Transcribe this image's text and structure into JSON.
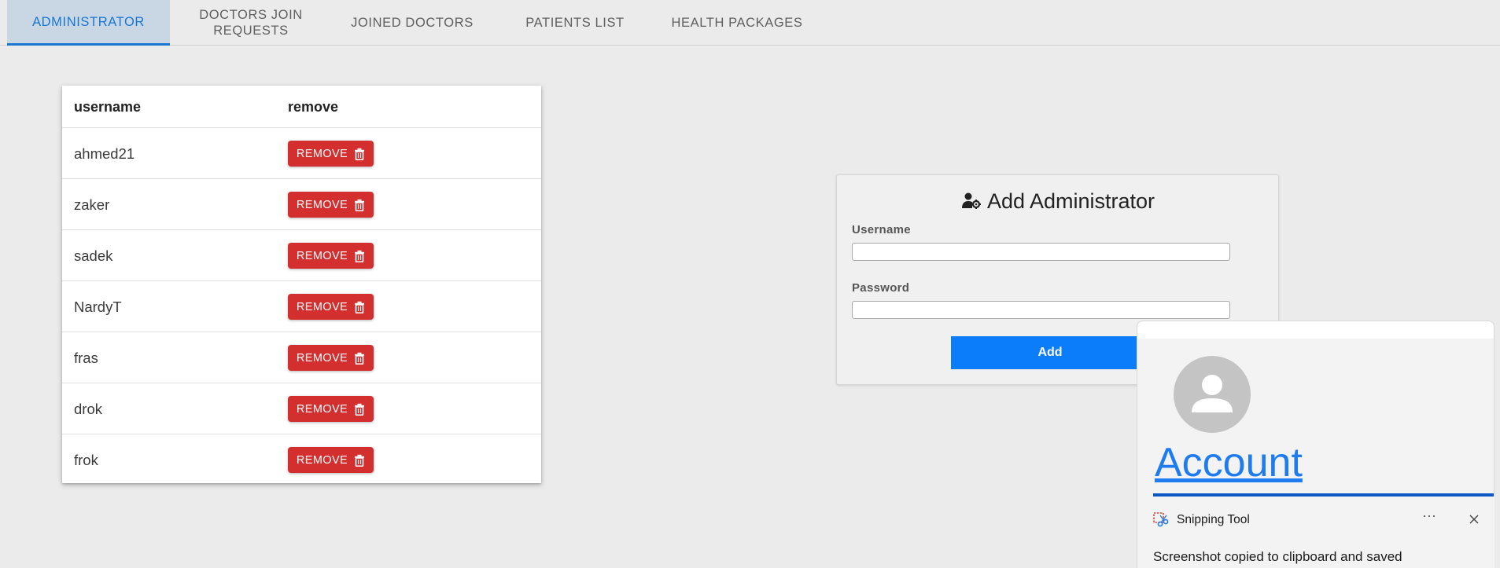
{
  "tabs": [
    {
      "label": "ADMINISTRATOR",
      "active": true
    },
    {
      "label": "DOCTORS JOIN REQUESTS",
      "line1": "DOCTORS JOIN",
      "line2": "REQUESTS"
    },
    {
      "label": "JOINED DOCTORS"
    },
    {
      "label": "PATIENTS LIST"
    },
    {
      "label": "HEALTH PACKAGES"
    }
  ],
  "table": {
    "headers": [
      "username",
      "remove"
    ],
    "remove_label": "REMOVE",
    "rows": [
      "ahmed21",
      "zaker",
      "sadek",
      "NardyT",
      "fras",
      "drok",
      "frok"
    ]
  },
  "form": {
    "title": "Add Administrator",
    "username_label": "Username",
    "username_value": "",
    "password_label": "Password",
    "password_value": "",
    "submit_label": "Add"
  },
  "popup": {
    "account_label": "Account"
  },
  "snipping": {
    "app_name": "Snipping Tool",
    "more_label": "···",
    "message": "Screenshot copied to clipboard and saved"
  },
  "colors": {
    "accent": "#1976d2",
    "remove": "#d32f2f",
    "add_button": "#0b7dfb",
    "account_link": "#1e7cf0"
  }
}
